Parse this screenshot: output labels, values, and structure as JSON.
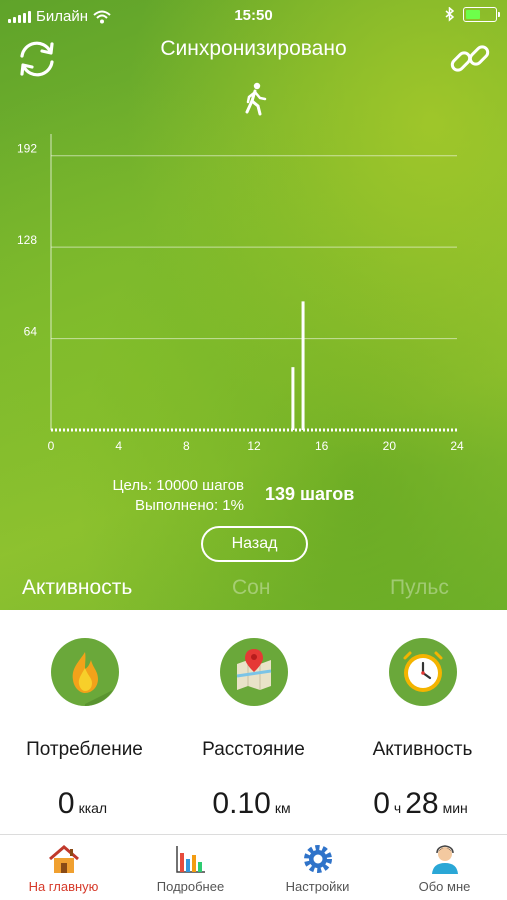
{
  "status_bar": {
    "carrier": "Билайн",
    "time": "15:50",
    "battery_fill": 0.5
  },
  "header": {
    "title": "Синхронизировано",
    "left_icon": "sync-icon",
    "right_icon": "link-icon",
    "activity_icon": "walking-person-icon"
  },
  "chart_data": {
    "type": "bar",
    "x": [
      0,
      4,
      8,
      12,
      16,
      20,
      24
    ],
    "x_tick_labels": [
      "0",
      "4",
      "8",
      "12",
      "16",
      "20",
      "24"
    ],
    "y_tick_labels": [
      "64",
      "128",
      "192"
    ],
    "y_ticks": [
      64,
      128,
      192
    ],
    "xlim": [
      0,
      24
    ],
    "ylim": [
      0,
      210
    ],
    "grid": true,
    "bars": [
      {
        "x": 14.3,
        "value": 44
      },
      {
        "x": 14.9,
        "value": 90
      }
    ],
    "color": "#ffffff"
  },
  "summary": {
    "goal": "Цель: 10000 шагов",
    "completed": "Выполнено: 1%",
    "steps": "139 шагов"
  },
  "back_button": "Назад",
  "tabs": [
    {
      "label": "Активность",
      "active": true
    },
    {
      "label": "Сон",
      "active": false
    },
    {
      "label": "Пульс",
      "active": false
    }
  ],
  "stats": [
    {
      "label": "Потребление",
      "value": "0",
      "unit": "ккал",
      "icon": "fire-icon",
      "color": "#6aa83a"
    },
    {
      "label": "Расстояние",
      "value": "0.10",
      "unit": "км",
      "icon": "map-pin-icon",
      "color": "#6aa83a"
    },
    {
      "label": "Активность",
      "value": "0",
      "unit": "ч",
      "value2": "28",
      "unit2": "мин",
      "icon": "clock-icon",
      "color": "#6aa83a"
    }
  ],
  "tabbar": [
    {
      "label": "На главную",
      "icon": "home-icon",
      "active": true
    },
    {
      "label": "Подробнее",
      "icon": "bar-chart-icon",
      "active": false
    },
    {
      "label": "Настройки",
      "icon": "gear-icon",
      "active": false
    },
    {
      "label": "Обо мне",
      "icon": "user-icon",
      "active": false
    }
  ],
  "colors": {
    "accent_green": "#6aa83a",
    "active_tab_red": "#d63a2a"
  }
}
